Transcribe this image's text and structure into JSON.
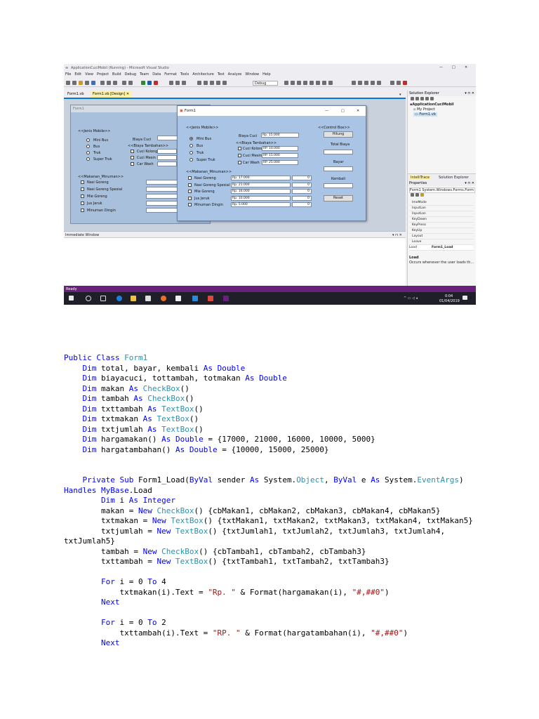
{
  "window": {
    "title": "ApplicationCuciMobil (Running) - Microsoft Visual Studio",
    "menu": [
      "File",
      "Edit",
      "View",
      "Project",
      "Build",
      "Debug",
      "Team",
      "Data",
      "Format",
      "Tools",
      "Architecture",
      "Test",
      "Analyze",
      "Window",
      "Help"
    ],
    "config": "Debug"
  },
  "doc_tabs": [
    "Form1.vb",
    "Form1.vb [Design]"
  ],
  "form_back": {
    "title": "Form1",
    "jenis_group": "<<Jenis Mobile>>",
    "vehicles": [
      "Mini Bus",
      "Bus",
      "Truk",
      "Super Truk"
    ],
    "biaya_cuci_label": "Biaya Cuci",
    "tambahan_group": "<<Biaya Tambahan>>",
    "tambahan": [
      "Cuci Kolong",
      "Cuci Mesin",
      "Car Wash"
    ],
    "makanan_group": "<<Makanan_Minuman>>",
    "makanan": [
      "Nasi Goreng",
      "Nasi Goreng Spesial",
      "Mie Goreng",
      "Jus Jeruk",
      "Minuman Dingin"
    ]
  },
  "form_front": {
    "title": "Form1",
    "jenis_group": "<<Jenis Mobile>>",
    "vehicles": [
      "Mini Bus",
      "Bus",
      "Truk",
      "Super Truk"
    ],
    "biaya_cuci_label": "Biaya Cuci",
    "biaya_cuci_value": "Rp. 15.000",
    "tambahan_group": "<<Biaya Tambahan>>",
    "tambahan": [
      {
        "label": "Cuci Kolong",
        "price": "RP. 10.000"
      },
      {
        "label": "Cuci Mesin",
        "price": "RP. 15.000"
      },
      {
        "label": "Car Wash",
        "price": "RP. 25.000"
      }
    ],
    "makanan_group": "<<Makanan_Minuman>>",
    "makanan": [
      {
        "label": "Nasi Goreng",
        "price": "Rp. 17.000",
        "qty": "0"
      },
      {
        "label": "Nasi Goreng Spesial",
        "price": "Rp. 21.000",
        "qty": "0"
      },
      {
        "label": "Mie Goreng",
        "price": "Rp. 16.000",
        "qty": "0"
      },
      {
        "label": "Jus Jeruk",
        "price": "Rp. 10.000",
        "qty": "0"
      },
      {
        "label": "Minuman Dingin",
        "price": "Rp. 5.000",
        "qty": "0"
      }
    ],
    "control_group": "<<Control Box>>",
    "hitung_button": "Hitung",
    "total_label": "Total Biaya",
    "bayar_label": "Bayar",
    "kembali_label": "Kembali",
    "reset_button": "Reset"
  },
  "immediate_title": "Immediate Window",
  "solution": {
    "title": "Solution Explorer",
    "items": [
      "ApplicationCuciMobil",
      "My Project",
      "Form1.vb"
    ],
    "tabs": [
      "IntelliTrace",
      "Solution Explorer"
    ]
  },
  "properties": {
    "title": "Properties",
    "object": "Form1 System.Windows.Forms.Form",
    "rows": [
      "ImeMode",
      "InputLan",
      "InputLan",
      "KeyDown",
      "KeyPress",
      "KeyUp",
      "Layout",
      "Leave"
    ],
    "load_label": "Load",
    "load_value": "Form1_Load",
    "desc_title": "Load",
    "desc_text": "Occurs whenever the user loads th..."
  },
  "status": "Ready",
  "clock": {
    "time": "0:04",
    "date": "01/04/2019"
  },
  "code_lines": [
    [
      [
        "kw",
        "Public Class "
      ],
      [
        "ty",
        "Form1"
      ]
    ],
    [
      [
        "",
        "    "
      ],
      [
        "kw",
        "Dim"
      ],
      [
        "",
        "",
        " total, bayar, kembali "
      ],
      [
        "kw",
        "As Double"
      ]
    ],
    [
      [
        "",
        "    "
      ],
      [
        "kw",
        "Dim"
      ],
      [
        "",
        " biayacuci, tottambah, totmakan "
      ],
      [
        "kw",
        "As Double"
      ]
    ],
    [
      [
        "",
        "    "
      ],
      [
        "kw",
        "Dim"
      ],
      [
        "",
        " makan "
      ],
      [
        "kw",
        "As "
      ],
      [
        "ty",
        "CheckBox"
      ],
      [
        "",
        "()"
      ]
    ],
    [
      [
        "",
        "    "
      ],
      [
        "kw",
        "Dim"
      ],
      [
        "",
        " tambah "
      ],
      [
        "kw",
        "As "
      ],
      [
        "ty",
        "CheckBox"
      ],
      [
        "",
        "()"
      ]
    ],
    [
      [
        "",
        "    "
      ],
      [
        "kw",
        "Dim"
      ],
      [
        "",
        " txttambah "
      ],
      [
        "kw",
        "As "
      ],
      [
        "ty",
        "TextBox"
      ],
      [
        "",
        "()"
      ]
    ],
    [
      [
        "",
        "    "
      ],
      [
        "kw",
        "Dim"
      ],
      [
        "",
        " txtmakan "
      ],
      [
        "kw",
        "As "
      ],
      [
        "ty",
        "TextBox"
      ],
      [
        "",
        "()"
      ]
    ],
    [
      [
        "",
        "    "
      ],
      [
        "kw",
        "Dim"
      ],
      [
        "",
        " txtjumlah "
      ],
      [
        "kw",
        "As "
      ],
      [
        "ty",
        "TextBox"
      ],
      [
        "",
        "()"
      ]
    ],
    [
      [
        "",
        "    "
      ],
      [
        "kw",
        "Dim"
      ],
      [
        "",
        " hargamakan() "
      ],
      [
        "kw",
        "As Double"
      ],
      [
        "",
        " = {17000, 21000, 16000, 10000, 5000}"
      ]
    ],
    [
      [
        "",
        "    "
      ],
      [
        "kw",
        "Dim"
      ],
      [
        "",
        " hargatambahan() "
      ],
      [
        "kw",
        "As Double"
      ],
      [
        "",
        " = {10000, 15000, 25000}"
      ]
    ],
    [],
    [],
    [
      [
        "",
        "    "
      ],
      [
        "kw",
        "Private Sub"
      ],
      [
        "",
        " Form1_Load("
      ],
      [
        "kw",
        "ByVal"
      ],
      [
        "",
        " sender "
      ],
      [
        "kw",
        "As"
      ],
      [
        "",
        " System."
      ],
      [
        "ty",
        "Object"
      ],
      [
        "",
        ", "
      ],
      [
        "kw",
        "ByVal"
      ],
      [
        "",
        " e "
      ],
      [
        "kw",
        "As"
      ],
      [
        "",
        " System."
      ],
      [
        "ty",
        "EventArgs"
      ],
      [
        "",
        ")"
      ]
    ],
    [
      [
        "kw",
        "Handles "
      ],
      [
        "kw",
        "MyBase"
      ],
      [
        "",
        ".Load"
      ]
    ],
    [
      [
        "",
        "        "
      ],
      [
        "kw",
        "Dim"
      ],
      [
        "",
        " i "
      ],
      [
        "kw",
        "As Integer"
      ]
    ],
    [
      [
        "",
        "        makan = "
      ],
      [
        "kw",
        "New "
      ],
      [
        "ty",
        "CheckBox"
      ],
      [
        "",
        "() {cbMakan1, cbMakan2, cbMakan3, cbMakan4, cbMakan5}"
      ]
    ],
    [
      [
        "",
        "        txtmakan = "
      ],
      [
        "kw",
        "New "
      ],
      [
        "ty",
        "TextBox"
      ],
      [
        "",
        "() {txtMakan1, txtMakan2, txtMakan3, txtMakan4, txtMakan5}"
      ]
    ],
    [
      [
        "",
        "        txtjumlah = "
      ],
      [
        "kw",
        "New "
      ],
      [
        "ty",
        "TextBox"
      ],
      [
        "",
        "() {txtJumlah1, txtJumlah2, txtJumlah3, txtJumlah4,"
      ]
    ],
    [
      [
        "",
        "txtJumlah5}"
      ]
    ],
    [
      [
        "",
        "        tambah = "
      ],
      [
        "kw",
        "New "
      ],
      [
        "ty",
        "CheckBox"
      ],
      [
        "",
        "() {cbTambah1, cbTambah2, cbTambah3}"
      ]
    ],
    [
      [
        "",
        "        txttambah = "
      ],
      [
        "kw",
        "New "
      ],
      [
        "ty",
        "TextBox"
      ],
      [
        "",
        "() {txtTambah1, txtTambah2, txtTambah3}"
      ]
    ],
    [],
    [
      [
        "",
        "        "
      ],
      [
        "kw",
        "For"
      ],
      [
        "",
        " i = 0 "
      ],
      [
        "kw",
        "To"
      ],
      [
        "",
        " 4"
      ]
    ],
    [
      [
        "",
        "            txtmakan(i).Text = "
      ],
      [
        "st",
        "\"Rp. \""
      ],
      [
        "",
        " & Format(hargamakan(i), "
      ],
      [
        "st",
        "\"#,##0\""
      ],
      [
        "",
        ")"
      ]
    ],
    [
      [
        "",
        "        "
      ],
      [
        "kw",
        "Next"
      ]
    ],
    [],
    [
      [
        "",
        "        "
      ],
      [
        "kw",
        "For"
      ],
      [
        "",
        " i = 0 "
      ],
      [
        "kw",
        "To"
      ],
      [
        "",
        " 2"
      ]
    ],
    [
      [
        "",
        "            txttambah(i).Text = "
      ],
      [
        "st",
        "\"RP. \""
      ],
      [
        "",
        " & Format(hargatambahan(i), "
      ],
      [
        "st",
        "\"#,##0\""
      ],
      [
        "",
        ")"
      ]
    ],
    [
      [
        "",
        "        "
      ],
      [
        "kw",
        "Next"
      ]
    ]
  ]
}
